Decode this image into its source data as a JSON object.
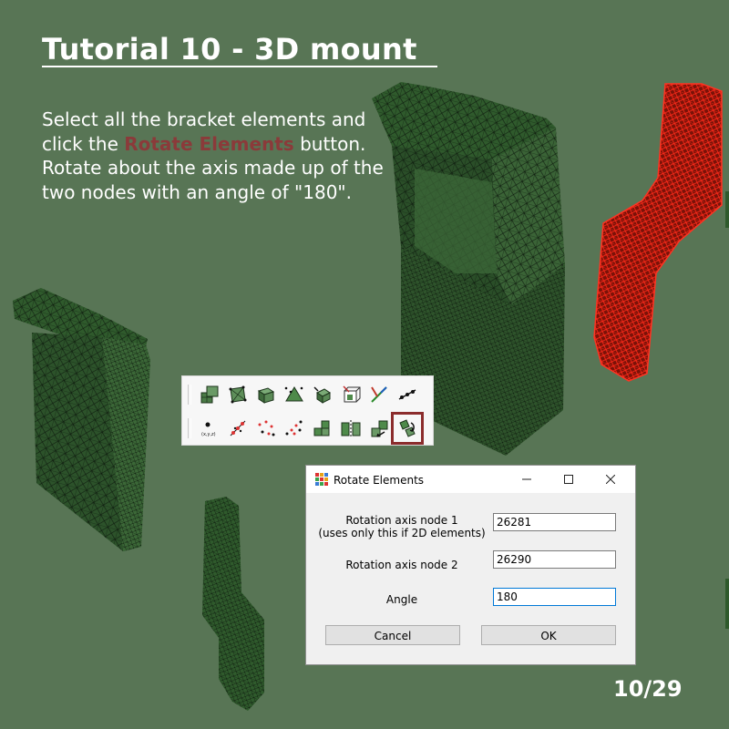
{
  "slide": {
    "title": "Tutorial 10 - 3D mount",
    "instruction_pre": "Select all the bracket elements and click the ",
    "instruction_highlight": "Rotate Elements",
    "instruction_post": " button. Rotate about the axis made up of the two nodes with an angle of \"180\".",
    "page": "10/29",
    "highlight_color": "#8b3a3a"
  },
  "toolbar": {
    "row1_icons": [
      "extrude-icon",
      "surface-mesh-icon",
      "solid-mesh-icon",
      "node-triangle-icon",
      "move-solid-icon",
      "cut-box-icon",
      "edge-line-icon",
      "line-nodes-icon"
    ],
    "row2_icons": [
      "point-coords-icon",
      "nodes-cloud-icon",
      "nodes-scatter-icon",
      "nodes-random-icon",
      "blocks-icon",
      "mirror-blocks-icon",
      "translate-elements-icon",
      "rotate-elements-icon"
    ],
    "active_icon": "rotate-elements-icon"
  },
  "dialog": {
    "title": "Rotate Elements",
    "label_node1_line1": "Rotation axis node 1",
    "label_node1_line2": "(uses only this if 2D elements)",
    "label_node2": "Rotation axis node 2",
    "label_angle": "Angle",
    "node1": "26281",
    "node2": "26290",
    "angle": "180",
    "cancel_label": "Cancel",
    "ok_label": "OK"
  }
}
